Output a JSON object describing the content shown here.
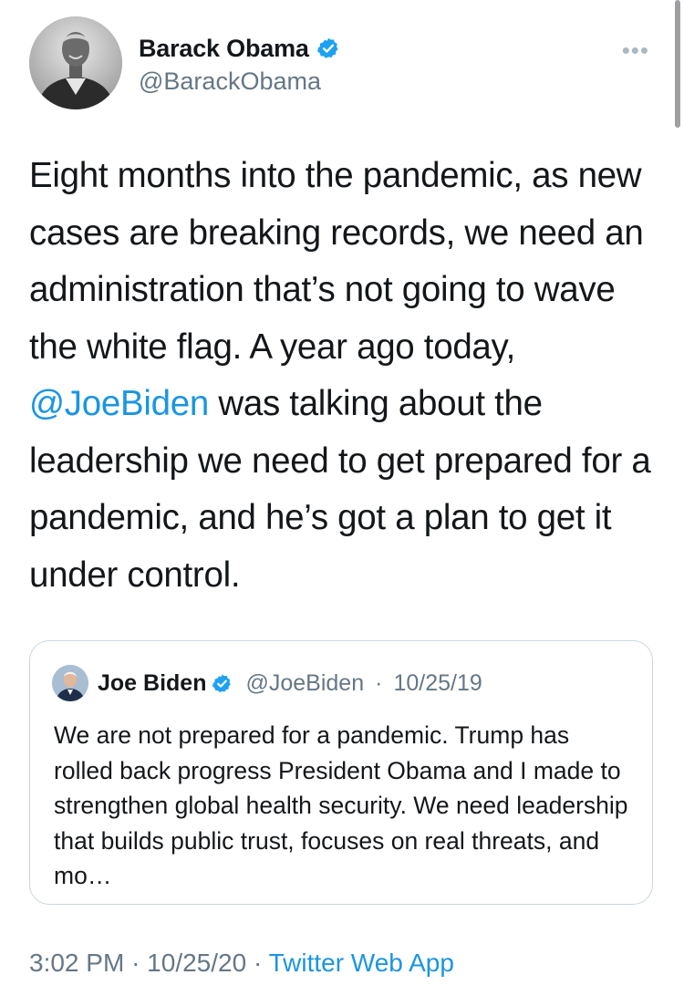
{
  "author": {
    "display_name": "Barack Obama",
    "handle": "@BarackObama",
    "avatar_icon": "profile-photo",
    "verified_icon": "verified-badge-icon"
  },
  "more_label": "•••",
  "tweet": {
    "text_before_mention": "Eight months into the pandemic, as new cases are breaking records, we need an administration that’s not going to wave the white flag. A year ago today, ",
    "mention": "@JoeBiden",
    "text_after_mention": " was talking about the leadership we need to get prepared for a pandemic, and he’s got a plan to get it under control."
  },
  "quoted_tweet": {
    "display_name": "Joe Biden",
    "handle": "@JoeBiden",
    "separator": "·",
    "date": "10/25/19",
    "text": "We are not prepared for a pandemic. Trump has rolled back progress President Obama and I made to strengthen global health security. We need leadership that builds public trust, focuses on real threats, and mo…"
  },
  "footer": {
    "time": "3:02 PM",
    "separator": "·",
    "date": "10/25/20",
    "source": "Twitter Web App"
  },
  "colors": {
    "link": "#1b95e0",
    "secondary_text": "#657786",
    "border": "#ccd6dd"
  }
}
